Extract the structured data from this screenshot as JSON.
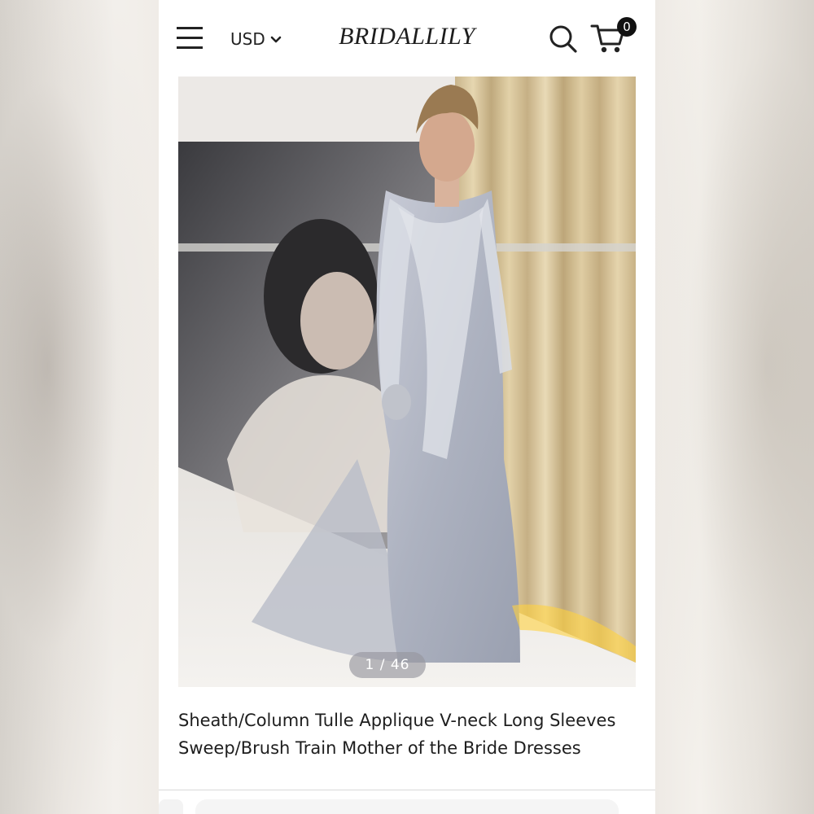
{
  "header": {
    "currency": "USD",
    "logo": "BRIDALLILY",
    "cart_count": "0"
  },
  "icons": {
    "menu": "hamburger-icon",
    "currency_dropdown": "chevron-down-icon",
    "search": "search-icon",
    "cart": "cart-icon"
  },
  "gallery": {
    "counter": "1 / 46",
    "current_index": 1,
    "total": 46
  },
  "product": {
    "title": "Sheath/Column Tulle Applique V-neck Long Sleeves Sweep/Brush Train Mother of the Bride Dresses"
  },
  "colors": {
    "text": "#1e1e1e",
    "badge_bg": "#111111",
    "counter_bg": "#96969e"
  }
}
